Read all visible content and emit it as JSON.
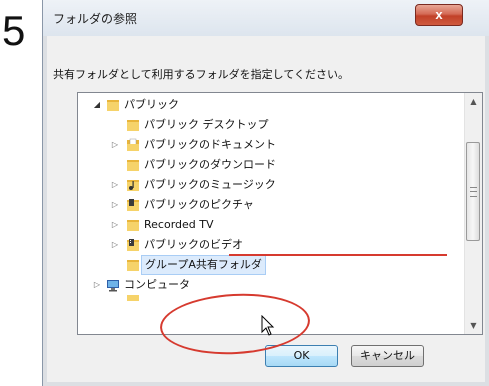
{
  "step_number": "5",
  "dialog": {
    "title": "フォルダの参照",
    "close_label": "x",
    "instruction": "共有フォルダとして利用するフォルダを指定してください。",
    "ok_label": "OK",
    "cancel_label": "キャンセル"
  },
  "tree": {
    "items": [
      {
        "label": "パブリック",
        "expander": "open",
        "icon": "folder-icon"
      },
      {
        "label": "パブリック デスクトップ",
        "expander": "none",
        "icon": "folder-icon"
      },
      {
        "label": "パブリックのドキュメント",
        "expander": "closed",
        "icon": "documents-folder-icon"
      },
      {
        "label": "パブリックのダウンロード",
        "expander": "none",
        "icon": "folder-icon"
      },
      {
        "label": "パブリックのミュージック",
        "expander": "closed",
        "icon": "music-folder-icon"
      },
      {
        "label": "パブリックのピクチャ",
        "expander": "closed",
        "icon": "pictures-folder-icon"
      },
      {
        "label": "Recorded TV",
        "expander": "closed",
        "icon": "folder-icon"
      },
      {
        "label": "パブリックのビデオ",
        "expander": "closed",
        "icon": "videos-folder-icon"
      },
      {
        "label": "グループA共有フォルダ",
        "expander": "none",
        "icon": "folder-icon",
        "selected": true
      },
      {
        "label": "コンピュータ",
        "expander": "closed",
        "icon": "computer-icon"
      }
    ]
  },
  "colors": {
    "annotation": "#d63a2f",
    "folder": "#f2c24b",
    "selection": "#dcebfc"
  }
}
